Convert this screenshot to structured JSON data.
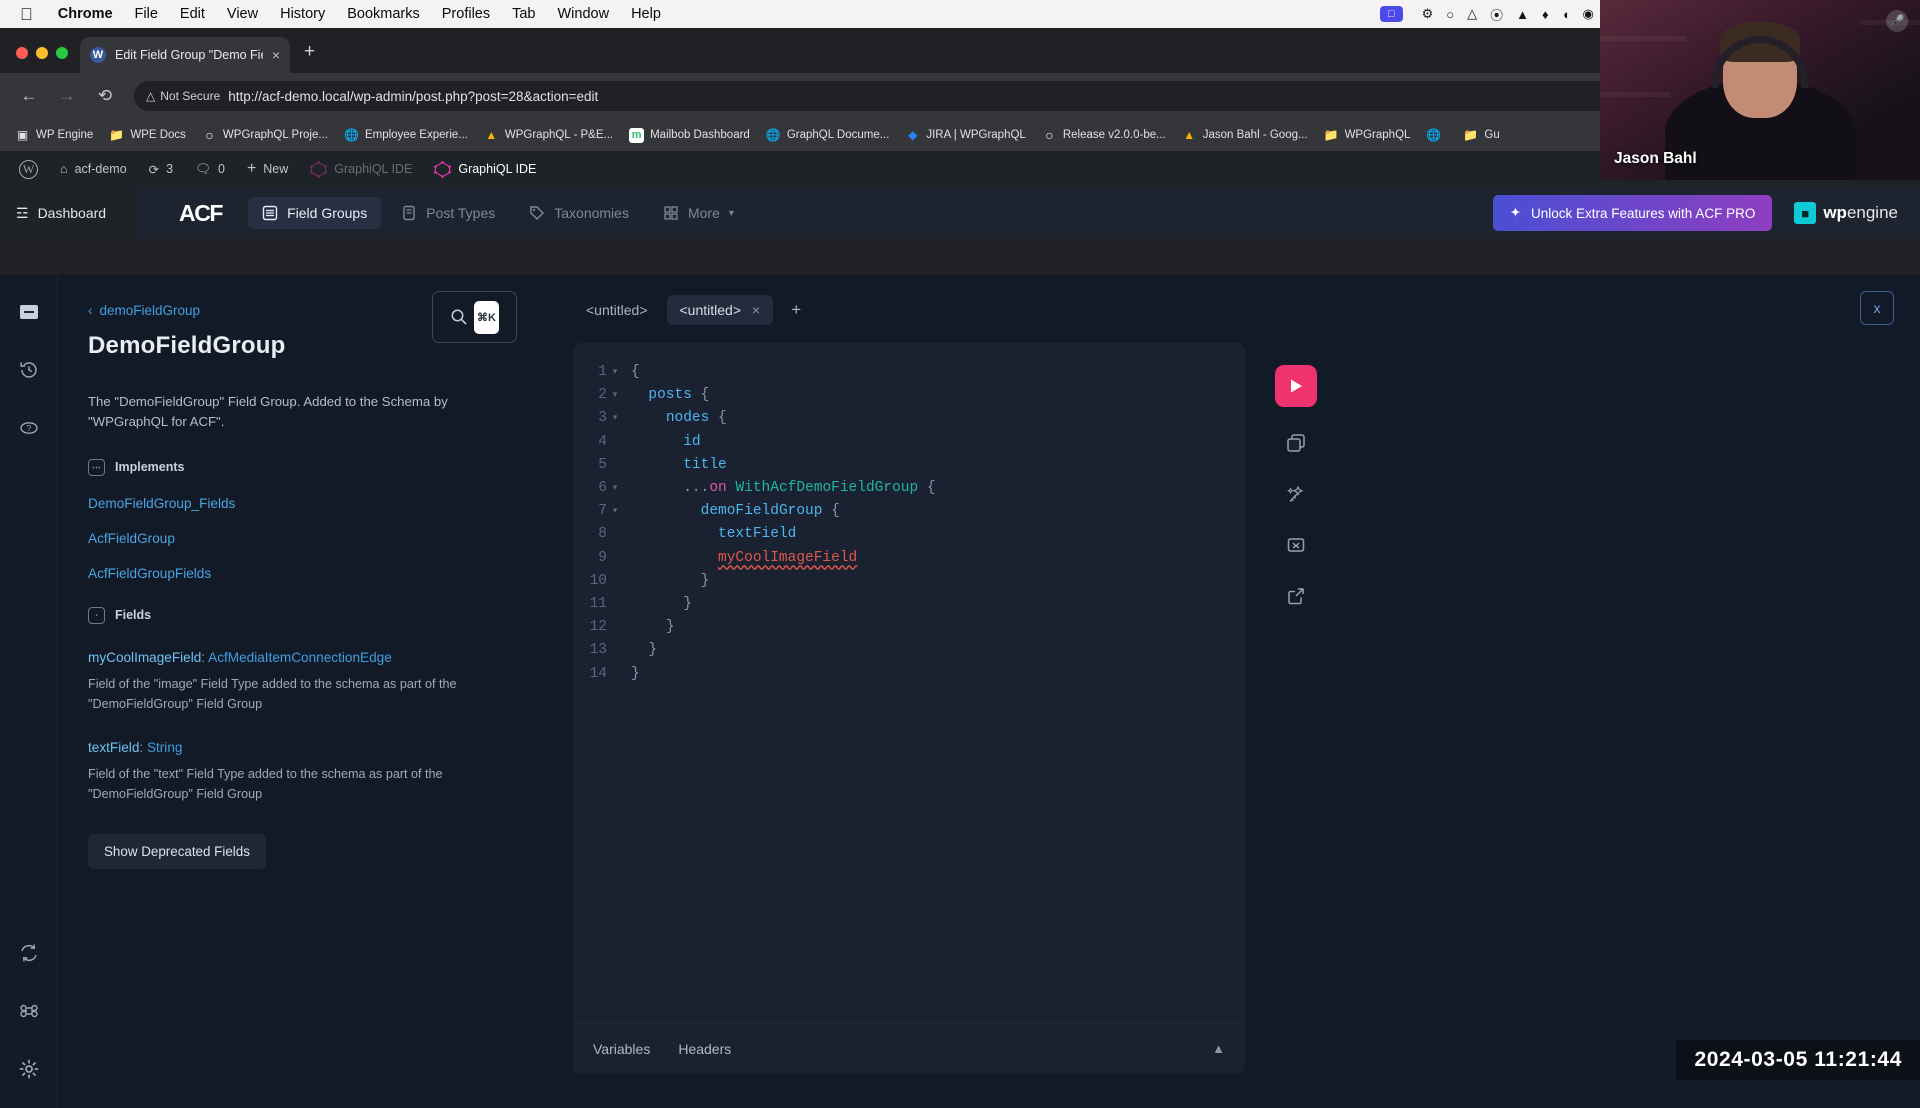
{
  "os_menubar": {
    "apple_icon": "apple-icon",
    "items": [
      {
        "label": "Chrome",
        "bold": true
      },
      {
        "label": "File",
        "bold": false
      },
      {
        "label": "Edit",
        "bold": false
      },
      {
        "label": "View",
        "bold": false
      },
      {
        "label": "History",
        "bold": false
      },
      {
        "label": "Bookmarks",
        "bold": false
      },
      {
        "label": "Profiles",
        "bold": false
      },
      {
        "label": "Tab",
        "bold": false
      },
      {
        "label": "Window",
        "bold": false
      },
      {
        "label": "Help",
        "bold": false
      }
    ],
    "status_icons": [
      "screen-share-icon",
      "backup-icon",
      "circle-icon",
      "fox-icon",
      "spiral-icon",
      "dropbox-icon",
      "flame-icon",
      "moon-phase-icon",
      "camera-icon",
      "grid-icon",
      "record-icon",
      "fingerprint-icon",
      "colors-icon",
      "night-shift-icon",
      "drive-icon",
      "headphones-icon",
      "bluetooth-icon",
      "battery-icon",
      "wifi-icon",
      "keyboard-icon",
      "search-icon",
      "control-center-icon"
    ]
  },
  "browser": {
    "tab": {
      "title": "Edit Field Group \"Demo Field",
      "favicon": "wordpress-icon",
      "close_label": "×"
    },
    "new_tab_label": "+",
    "nav": {
      "back": "back-arrow-icon",
      "forward": "forward-arrow-icon",
      "reload": "reload-icon"
    },
    "omnibox": {
      "security_label": "Not Secure",
      "security_icon": "warning-triangle-icon",
      "url": "http://acf-demo.local/wp-admin/post.php?post=28&action=edit",
      "bookmark_star": "star-icon",
      "info_icon": "info-icon"
    },
    "bookmarks": [
      {
        "label": "WP Engine",
        "icon": "wpengine-icon"
      },
      {
        "label": "WPE Docs",
        "icon": "folder-icon"
      },
      {
        "label": "WPGraphQL Proje...",
        "icon": "github-icon"
      },
      {
        "label": "Employee Experie...",
        "icon": "globe-icon"
      },
      {
        "label": "WPGraphQL - P&E...",
        "icon": "google-drive-icon"
      },
      {
        "label": "Mailbob Dashboard",
        "icon": "mailbob-icon"
      },
      {
        "label": "GraphQL Docume...",
        "icon": "globe-icon"
      },
      {
        "label": "JIRA | WPGraphQL",
        "icon": "jira-icon"
      },
      {
        "label": "Release v2.0.0-be...",
        "icon": "github-icon"
      },
      {
        "label": "Jason Bahl - Goog...",
        "icon": "google-drive-icon"
      },
      {
        "label": "WPGraphQL",
        "icon": "folder-icon"
      },
      {
        "label": "",
        "icon": "globe-icon"
      },
      {
        "label": "Gu",
        "icon": "folder-icon"
      }
    ]
  },
  "wp_adminbar": {
    "logo": "wordpress-icon",
    "site_name": "acf-demo",
    "site_icon": "home-icon",
    "updates_icon": "updates-icon",
    "updates_count": "3",
    "comments_icon": "comment-icon",
    "comments_count": "0",
    "new_icon": "plus-icon",
    "new_label": "New",
    "graphiql_ide_1": "GraphiQL IDE",
    "graphiql_ide_2": "GraphiQL IDE",
    "graphiql_icon": "graphql-icon"
  },
  "acf_header": {
    "dashboard_label": "Dashboard",
    "dashboard_icon": "dashboard-icon",
    "logo_text": "ACF",
    "tabs": [
      {
        "label": "Field Groups",
        "icon": "field-groups-icon",
        "active": true
      },
      {
        "label": "Post Types",
        "icon": "post-types-icon",
        "active": false
      },
      {
        "label": "Taxonomies",
        "icon": "tag-icon",
        "active": false
      },
      {
        "label": "More",
        "icon": "grid-icon",
        "active": false,
        "chevron": "chevron-down-icon"
      }
    ],
    "pro_button": {
      "label": "Unlock Extra Features with ACF PRO",
      "icon": "sparkle-icon"
    },
    "wpengine": {
      "bold": "wp",
      "light": "engine",
      "mark": "wpe-logo-icon"
    }
  },
  "graphiql": {
    "sidebar_icons": [
      {
        "name": "docs-icon",
        "active": true
      },
      {
        "name": "history-clock-icon",
        "active": false
      },
      {
        "name": "help-question-icon",
        "active": false
      },
      {
        "name": "refresh-icon",
        "active": false
      },
      {
        "name": "keyboard-shortcuts-icon",
        "active": false
      },
      {
        "name": "settings-gear-icon",
        "active": false
      }
    ],
    "close_button_label": "x",
    "docs": {
      "breadcrumb_back_icon": "chevron-left-icon",
      "breadcrumb_label": "demoFieldGroup",
      "title": "DemoFieldGroup",
      "description": "The \"DemoFieldGroup\" Field Group. Added to the Schema by \"WPGraphQL for ACF\".",
      "implements_label": "Implements",
      "implements": [
        "DemoFieldGroup_Fields",
        "AcfFieldGroup",
        "AcfFieldGroupFields"
      ],
      "fields_label": "Fields",
      "fields": [
        {
          "name": "myCoolImageField",
          "type": "AcfMediaItemConnectionEdge",
          "description": "Field of the \"image\" Field Type added to the schema as part of the \"DemoFieldGroup\" Field Group"
        },
        {
          "name": "textField",
          "type": "String",
          "description": "Field of the \"text\" Field Type added to the schema as part of the \"DemoFieldGroup\" Field Group"
        }
      ],
      "show_deprecated_label": "Show Deprecated Fields",
      "search_icon": "search-icon",
      "search_shortcut_key": "⌘K"
    },
    "editor": {
      "tabs": [
        {
          "label": "<untitled>",
          "active": false,
          "closeable": false
        },
        {
          "label": "<untitled>",
          "active": true,
          "closeable": true,
          "close_label": "×"
        }
      ],
      "add_tab_label": "+",
      "toolbar": [
        {
          "name": "execute-query-button",
          "icon": "play-icon"
        },
        {
          "name": "copy-query-button",
          "icon": "copy-icon"
        },
        {
          "name": "prettify-query-button",
          "icon": "magic-wand-icon"
        },
        {
          "name": "merge-fragments-button",
          "icon": "merge-icon"
        },
        {
          "name": "open-external-button",
          "icon": "external-link-icon"
        }
      ],
      "code_lines": [
        {
          "n": "1",
          "fold": "▾",
          "tokens": [
            {
              "t": "{",
              "c": "punct"
            }
          ],
          "indent": 0
        },
        {
          "n": "2",
          "fold": "▾",
          "tokens": [
            {
              "t": "posts",
              "c": "field"
            },
            {
              "t": " {",
              "c": "punct"
            }
          ],
          "indent": 1
        },
        {
          "n": "3",
          "fold": "▾",
          "tokens": [
            {
              "t": "nodes",
              "c": "field"
            },
            {
              "t": " {",
              "c": "punct"
            }
          ],
          "indent": 2
        },
        {
          "n": "4",
          "fold": "",
          "tokens": [
            {
              "t": "id",
              "c": "field"
            }
          ],
          "indent": 3
        },
        {
          "n": "5",
          "fold": "",
          "tokens": [
            {
              "t": "title",
              "c": "field"
            }
          ],
          "indent": 3
        },
        {
          "n": "6",
          "fold": "▾",
          "tokens": [
            {
              "t": "...",
              "c": "punct"
            },
            {
              "t": "on ",
              "c": "kw"
            },
            {
              "t": "WithAcfDemoFieldGroup",
              "c": "type"
            },
            {
              "t": " {",
              "c": "punct"
            }
          ],
          "indent": 3
        },
        {
          "n": "7",
          "fold": "▾",
          "tokens": [
            {
              "t": "demoFieldGroup",
              "c": "field"
            },
            {
              "t": " {",
              "c": "punct"
            }
          ],
          "indent": 4
        },
        {
          "n": "8",
          "fold": "",
          "tokens": [
            {
              "t": "textField",
              "c": "field"
            }
          ],
          "indent": 5
        },
        {
          "n": "9",
          "fold": "",
          "tokens": [
            {
              "t": "myCoolImageField",
              "c": "err"
            }
          ],
          "indent": 5
        },
        {
          "n": "10",
          "fold": "",
          "tokens": [
            {
              "t": "}",
              "c": "punct"
            }
          ],
          "indent": 4
        },
        {
          "n": "11",
          "fold": "",
          "tokens": [
            {
              "t": "}",
              "c": "punct"
            }
          ],
          "indent": 3
        },
        {
          "n": "12",
          "fold": "",
          "tokens": [
            {
              "t": "}",
              "c": "punct"
            }
          ],
          "indent": 2
        },
        {
          "n": "13",
          "fold": "",
          "tokens": [
            {
              "t": "}",
              "c": "punct"
            }
          ],
          "indent": 1
        },
        {
          "n": "14",
          "fold": "",
          "tokens": [
            {
              "t": "}",
              "c": "punct"
            }
          ],
          "indent": 0
        }
      ],
      "footer": {
        "variables_label": "Variables",
        "headers_label": "Headers",
        "collapse_icon": "chevron-up-icon"
      }
    }
  },
  "overlay": {
    "webcam_name": "Jason Bahl",
    "mic_icon": "microphone-icon",
    "timestamp": "2024-03-05  11:21:44"
  },
  "colors": {
    "accent_pink": "#f0326f",
    "link_blue": "#4aa3e3",
    "type_teal": "#1fb6a0",
    "keyword_pink": "#e255a1",
    "error_red": "#e2574c",
    "acf_pro_gradient_start": "#4a4fd4",
    "acf_pro_gradient_end": "#8e3ec0",
    "editor_bg": "#1a2231",
    "app_bg": "#131a27"
  }
}
